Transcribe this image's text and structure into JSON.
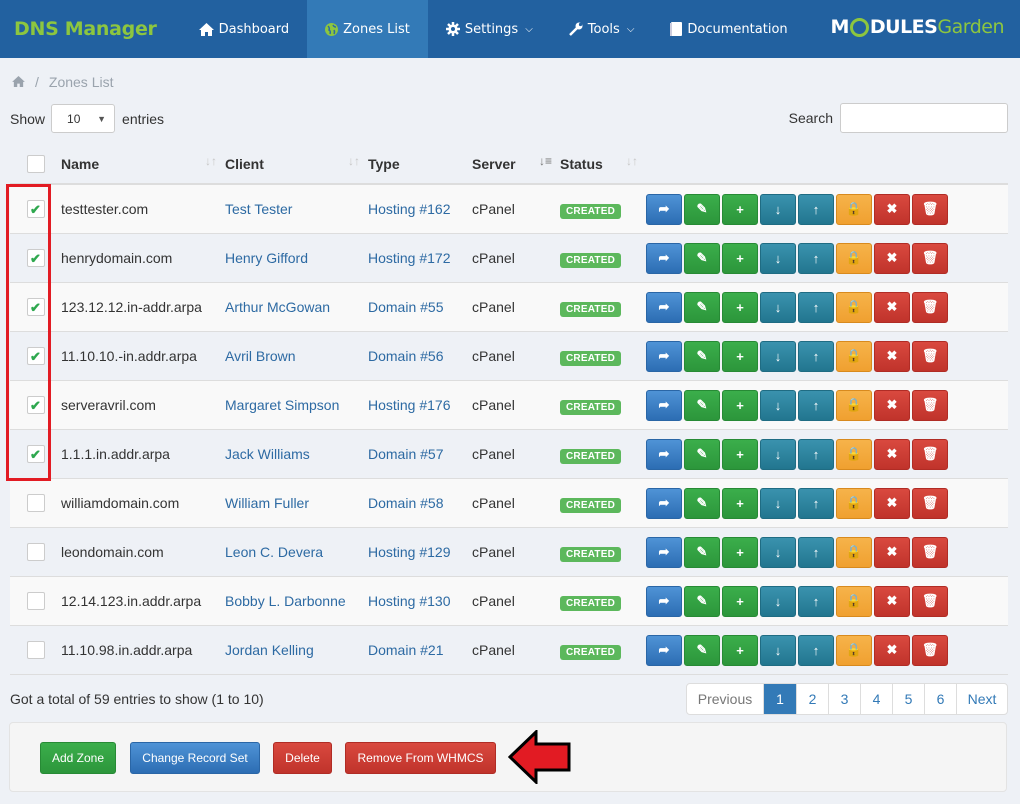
{
  "navbar": {
    "brand": "DNS Manager",
    "items": [
      {
        "label": "Dashboard",
        "icon": "home-icon",
        "active": false
      },
      {
        "label": "Zones List",
        "icon": "globe-icon",
        "active": true
      },
      {
        "label": "Settings",
        "icon": "gear-icon",
        "dropdown": true
      },
      {
        "label": "Tools",
        "icon": "wrench-icon",
        "dropdown": true
      },
      {
        "label": "Documentation",
        "icon": "book-icon"
      }
    ],
    "logo": {
      "part1": "M",
      "part2": "DULES",
      "part3": "Garden"
    }
  },
  "breadcrumb": {
    "home_icon": "home-icon",
    "separator": "/",
    "current": "Zones List"
  },
  "controls": {
    "show_label": "Show",
    "page_size": "10",
    "entries_label": "entries",
    "search_label": "Search",
    "search_value": ""
  },
  "table": {
    "columns": [
      "Name",
      "Client",
      "Type",
      "Server",
      "Status"
    ],
    "rows": [
      {
        "checked": true,
        "name": "testtester.com",
        "client": "Test Tester",
        "type": "Hosting #162",
        "server": "cPanel",
        "status": "CREATED"
      },
      {
        "checked": true,
        "name": "henrydomain.com",
        "client": "Henry Gifford",
        "type": "Hosting #172",
        "server": "cPanel",
        "status": "CREATED"
      },
      {
        "checked": true,
        "name": "123.12.12.in-addr.arpa",
        "client": "Arthur McGowan",
        "type": "Domain #55",
        "server": "cPanel",
        "status": "CREATED"
      },
      {
        "checked": true,
        "name": "11.10.10.-in.addr.arpa",
        "client": "Avril Brown",
        "type": "Domain #56",
        "server": "cPanel",
        "status": "CREATED"
      },
      {
        "checked": true,
        "name": "serveravril.com",
        "client": "Margaret Simpson",
        "type": "Hosting #176",
        "server": "cPanel",
        "status": "CREATED"
      },
      {
        "checked": true,
        "name": "1.1.1.in.addr.arpa",
        "client": "Jack Williams",
        "type": "Domain #57",
        "server": "cPanel",
        "status": "CREATED"
      },
      {
        "checked": false,
        "name": "williamdomain.com",
        "client": "William Fuller",
        "type": "Domain #58",
        "server": "cPanel",
        "status": "CREATED"
      },
      {
        "checked": false,
        "name": "leondomain.com",
        "client": "Leon C. Devera",
        "type": "Hosting #129",
        "server": "cPanel",
        "status": "CREATED"
      },
      {
        "checked": false,
        "name": "12.14.123.in.addr.arpa",
        "client": "Bobby L. Darbonne",
        "type": "Hosting #130",
        "server": "cPanel",
        "status": "CREATED"
      },
      {
        "checked": false,
        "name": "11.10.98.in.addr.arpa",
        "client": "Jordan Kelling",
        "type": "Domain #21",
        "server": "cPanel",
        "status": "CREATED"
      }
    ],
    "row_actions": [
      {
        "icon": "share-icon",
        "glyph": "➦",
        "color": "blue"
      },
      {
        "icon": "pencil-icon",
        "glyph": "✎",
        "color": "green"
      },
      {
        "icon": "plus-icon",
        "glyph": "+",
        "color": "green"
      },
      {
        "icon": "arrow-down-icon",
        "glyph": "↓",
        "color": "teal"
      },
      {
        "icon": "arrow-up-icon",
        "glyph": "↑",
        "color": "teal"
      },
      {
        "icon": "lock-icon",
        "glyph": "🔒",
        "color": "orange"
      },
      {
        "icon": "close-icon",
        "glyph": "✖",
        "color": "red"
      },
      {
        "icon": "trash-icon",
        "glyph": "🗑",
        "color": "red"
      }
    ]
  },
  "footer": {
    "info": "Got a total of 59 entries to show (1 to 10)",
    "pagination": {
      "previous": "Previous",
      "pages": [
        "1",
        "2",
        "3",
        "4",
        "5",
        "6"
      ],
      "active": "1",
      "next": "Next"
    }
  },
  "bulk_actions": {
    "add_zone": "Add Zone",
    "change_record_set": "Change Record Set",
    "delete": "Delete",
    "remove_from_whmcs": "Remove From WHMCS"
  },
  "colors": {
    "navbar": "#2261a0",
    "brand": "#8dc63f",
    "active_nav": "#337ab7",
    "annotation": "#e21b23"
  }
}
